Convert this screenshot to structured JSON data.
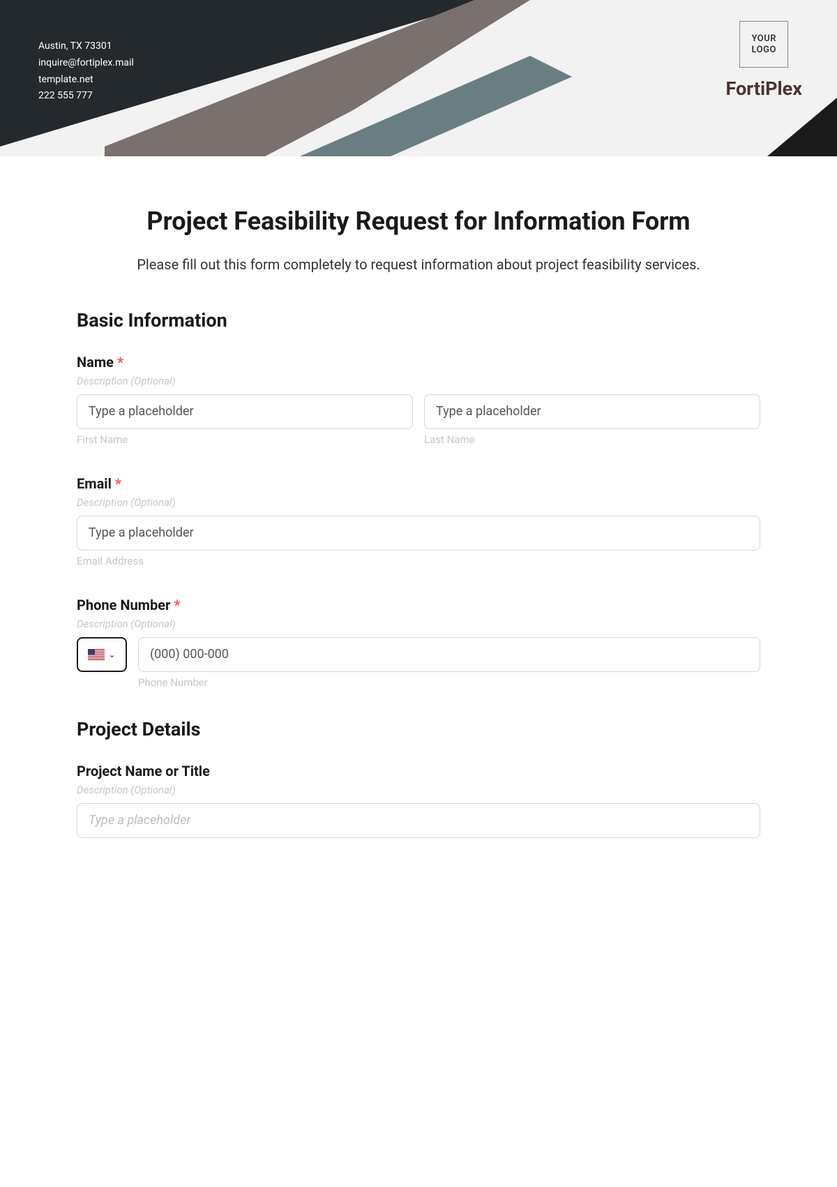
{
  "header": {
    "contact": {
      "address": "Austin, TX 73301",
      "email": "inquire@fortiplex.mail",
      "website": "template.net",
      "phone": "222 555 777"
    },
    "logo_text_line1": "YOUR",
    "logo_text_line2": "LOGO",
    "company_name": "FortiPlex"
  },
  "form": {
    "title": "Project Feasibility Request for Information Form",
    "description": "Please fill out this form completely to request information about project feasibility services."
  },
  "sections": {
    "basic_info": {
      "heading": "Basic Information",
      "name": {
        "label": "Name",
        "required": "*",
        "desc": "Description (Optional)",
        "first_placeholder": "Type a placeholder",
        "last_placeholder": "Type a placeholder",
        "first_sublabel": "First Name",
        "last_sublabel": "Last Name"
      },
      "email": {
        "label": "Email",
        "required": "*",
        "desc": "Description (Optional)",
        "placeholder": "Type a placeholder",
        "sublabel": "Email Address"
      },
      "phone": {
        "label": "Phone Number",
        "required": "*",
        "desc": "Description (Optional)",
        "placeholder": "(000) 000-000",
        "sublabel": "Phone Number"
      }
    },
    "project_details": {
      "heading": "Project Details",
      "project_name": {
        "label": "Project Name or Title",
        "desc": "Description (Optional)",
        "placeholder": "Type a placeholder"
      }
    }
  }
}
